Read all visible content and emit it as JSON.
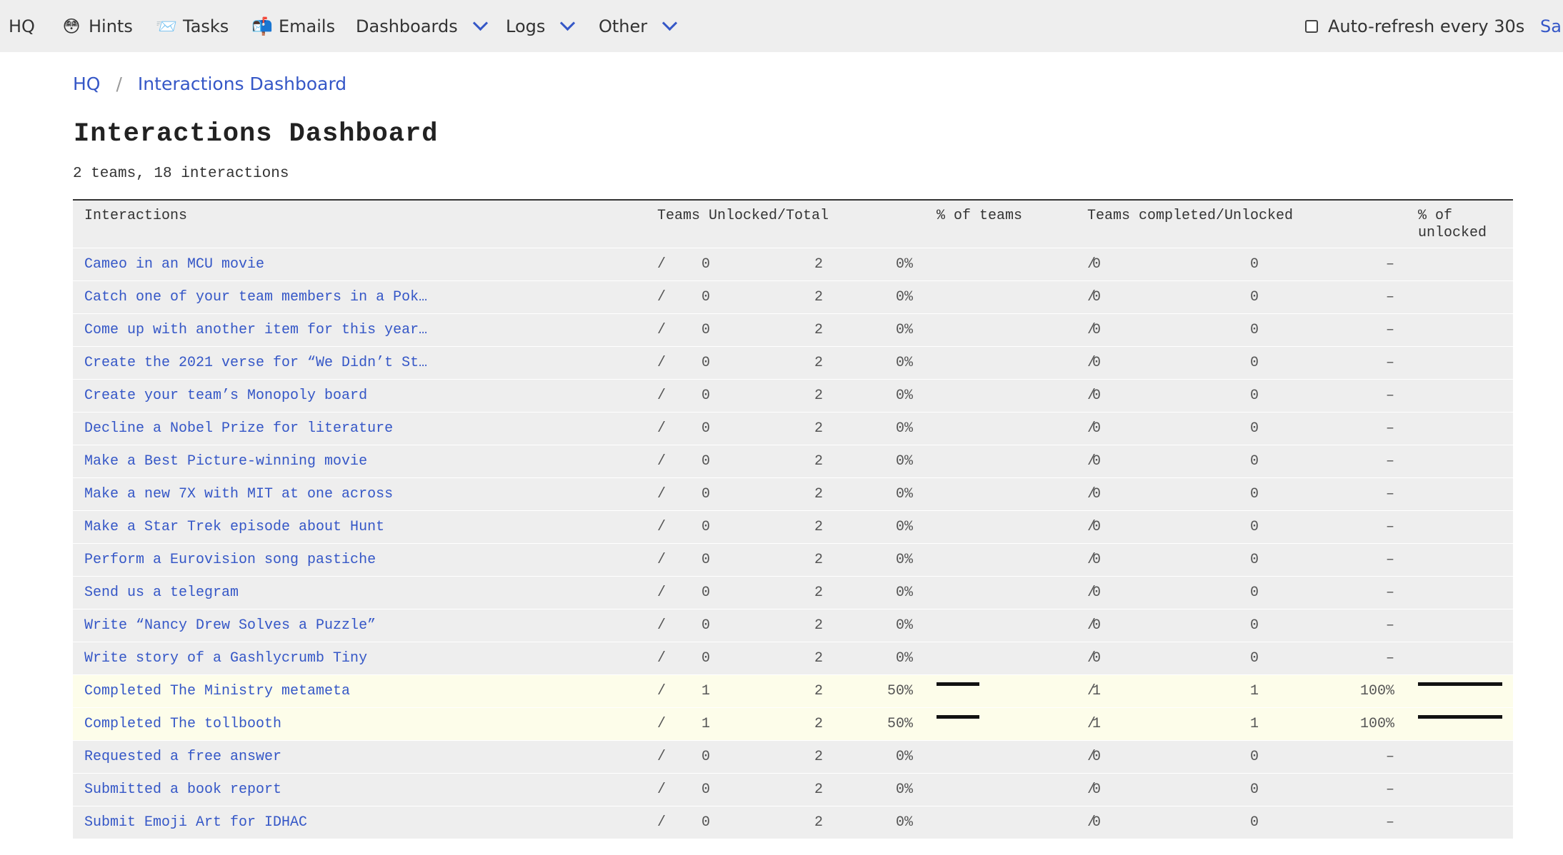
{
  "nav": {
    "hq": "HQ",
    "hints": {
      "emoji": "😳",
      "label": "Hints"
    },
    "tasks": {
      "emoji": "📨",
      "label": "Tasks"
    },
    "emails": {
      "emoji": "📬",
      "label": "Emails"
    },
    "dashboards": "Dashboards",
    "logs": "Logs",
    "other": "Other",
    "autorefresh": "Auto-refresh every 30s",
    "autorefresh_checked": false,
    "edge_text": "Sal"
  },
  "breadcrumb": {
    "root": "HQ",
    "separator": "/",
    "current": "Interactions Dashboard"
  },
  "title": "Interactions Dashboard",
  "summary": "2 teams, 18 interactions",
  "table": {
    "headers": {
      "interactions": "Interactions",
      "teams_unlocked_total": "Teams Unlocked/Total",
      "pct_teams": "% of teams",
      "teams_completed_unlocked": "Teams completed/Unlocked",
      "pct_unlocked_line1": "% of",
      "pct_unlocked_line2": "unlocked"
    },
    "separator": "/",
    "rows": [
      {
        "name": "Cameo in an MCU movie",
        "unlocked": "0",
        "total": "2",
        "pct": "0%",
        "pct_frac": 0,
        "completed": "0",
        "unlocked2": "0",
        "pct2": "–",
        "pct2_frac": 0,
        "highlight": false
      },
      {
        "name": "Catch one of your team members in a Pok…",
        "unlocked": "0",
        "total": "2",
        "pct": "0%",
        "pct_frac": 0,
        "completed": "0",
        "unlocked2": "0",
        "pct2": "–",
        "pct2_frac": 0,
        "highlight": false
      },
      {
        "name": "Come up with another item for this year…",
        "unlocked": "0",
        "total": "2",
        "pct": "0%",
        "pct_frac": 0,
        "completed": "0",
        "unlocked2": "0",
        "pct2": "–",
        "pct2_frac": 0,
        "highlight": false
      },
      {
        "name": "Create the 2021 verse for “We Didn’t St…",
        "unlocked": "0",
        "total": "2",
        "pct": "0%",
        "pct_frac": 0,
        "completed": "0",
        "unlocked2": "0",
        "pct2": "–",
        "pct2_frac": 0,
        "highlight": false
      },
      {
        "name": "Create your team’s Monopoly board",
        "unlocked": "0",
        "total": "2",
        "pct": "0%",
        "pct_frac": 0,
        "completed": "0",
        "unlocked2": "0",
        "pct2": "–",
        "pct2_frac": 0,
        "highlight": false
      },
      {
        "name": "Decline a Nobel Prize for literature",
        "unlocked": "0",
        "total": "2",
        "pct": "0%",
        "pct_frac": 0,
        "completed": "0",
        "unlocked2": "0",
        "pct2": "–",
        "pct2_frac": 0,
        "highlight": false
      },
      {
        "name": "Make a Best Picture-winning movie",
        "unlocked": "0",
        "total": "2",
        "pct": "0%",
        "pct_frac": 0,
        "completed": "0",
        "unlocked2": "0",
        "pct2": "–",
        "pct2_frac": 0,
        "highlight": false
      },
      {
        "name": "Make a new 7X with MIT at one across",
        "unlocked": "0",
        "total": "2",
        "pct": "0%",
        "pct_frac": 0,
        "completed": "0",
        "unlocked2": "0",
        "pct2": "–",
        "pct2_frac": 0,
        "highlight": false
      },
      {
        "name": "Make a Star Trek episode about Hunt",
        "unlocked": "0",
        "total": "2",
        "pct": "0%",
        "pct_frac": 0,
        "completed": "0",
        "unlocked2": "0",
        "pct2": "–",
        "pct2_frac": 0,
        "highlight": false
      },
      {
        "name": "Perform a Eurovision song pastiche",
        "unlocked": "0",
        "total": "2",
        "pct": "0%",
        "pct_frac": 0,
        "completed": "0",
        "unlocked2": "0",
        "pct2": "–",
        "pct2_frac": 0,
        "highlight": false
      },
      {
        "name": "Send us a telegram",
        "unlocked": "0",
        "total": "2",
        "pct": "0%",
        "pct_frac": 0,
        "completed": "0",
        "unlocked2": "0",
        "pct2": "–",
        "pct2_frac": 0,
        "highlight": false
      },
      {
        "name": "Write “Nancy Drew Solves a Puzzle”",
        "unlocked": "0",
        "total": "2",
        "pct": "0%",
        "pct_frac": 0,
        "completed": "0",
        "unlocked2": "0",
        "pct2": "–",
        "pct2_frac": 0,
        "highlight": false
      },
      {
        "name": "Write story of a Gashlycrumb Tiny",
        "unlocked": "0",
        "total": "2",
        "pct": "0%",
        "pct_frac": 0,
        "completed": "0",
        "unlocked2": "0",
        "pct2": "–",
        "pct2_frac": 0,
        "highlight": false
      },
      {
        "name": "Completed The Ministry metameta",
        "unlocked": "1",
        "total": "2",
        "pct": "50%",
        "pct_frac": 0.5,
        "completed": "1",
        "unlocked2": "1",
        "pct2": "100%",
        "pct2_frac": 1,
        "highlight": true
      },
      {
        "name": "Completed The tollbooth",
        "unlocked": "1",
        "total": "2",
        "pct": "50%",
        "pct_frac": 0.5,
        "completed": "1",
        "unlocked2": "1",
        "pct2": "100%",
        "pct2_frac": 1,
        "highlight": true
      },
      {
        "name": "Requested a free answer",
        "unlocked": "0",
        "total": "2",
        "pct": "0%",
        "pct_frac": 0,
        "completed": "0",
        "unlocked2": "0",
        "pct2": "–",
        "pct2_frac": 0,
        "highlight": false
      },
      {
        "name": "Submitted a book report",
        "unlocked": "0",
        "total": "2",
        "pct": "0%",
        "pct_frac": 0,
        "completed": "0",
        "unlocked2": "0",
        "pct2": "–",
        "pct2_frac": 0,
        "highlight": false
      },
      {
        "name": "Submit Emoji Art for IDHAC",
        "unlocked": "0",
        "total": "2",
        "pct": "0%",
        "pct_frac": 0,
        "completed": "0",
        "unlocked2": "0",
        "pct2": "–",
        "pct2_frac": 0,
        "highlight": false
      }
    ]
  },
  "colors": {
    "link": "#3557c7",
    "highlight_row": "#fdfdea",
    "row_bg": "#eeeeee",
    "bar": "#111111"
  }
}
